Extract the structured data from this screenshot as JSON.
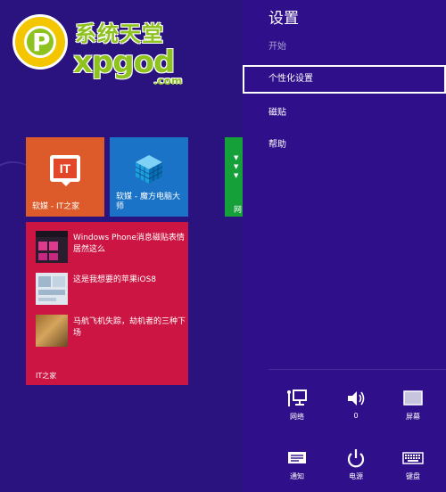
{
  "watermark": {
    "logo_letter": "P",
    "cn_text": "系统天堂",
    "en_text": "xpgod",
    "domain_suffix": ".com"
  },
  "tiles": {
    "ithome": {
      "icon_text": "IT",
      "label": "软媒 - IT之家",
      "color": "#dd5a2b"
    },
    "mofang": {
      "label": "软媒 - 魔方电脑大师",
      "color": "#1a73c6"
    },
    "green": {
      "label": "网",
      "color": "#16a03a"
    },
    "news": {
      "color": "#cc1543",
      "items": [
        {
          "title": "Windows Phone消息磁贴表情居然这么"
        },
        {
          "title": "这是我想要的苹果iOS8"
        },
        {
          "title": "马航飞机失踪，劫机者的三种下场"
        }
      ],
      "source": "IT之家"
    }
  },
  "settings": {
    "title": "设置",
    "subtitle": "开始",
    "items": [
      {
        "label": "个性化设置",
        "selected": true
      },
      {
        "label": "磁贴",
        "selected": false
      },
      {
        "label": "帮助",
        "selected": false
      }
    ],
    "system": {
      "network": {
        "label": "网络",
        "icon": "network-icon"
      },
      "volume": {
        "label": "0",
        "icon": "volume-icon"
      },
      "screen": {
        "label": "屏幕",
        "icon": "screen-icon"
      },
      "notifications": {
        "label": "通知",
        "icon": "notification-icon"
      },
      "power": {
        "label": "电源",
        "icon": "power-icon"
      },
      "keyboard": {
        "label": "键盘",
        "icon": "keyboard-icon"
      }
    }
  }
}
